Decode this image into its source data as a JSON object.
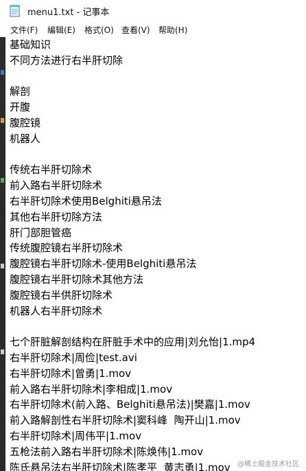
{
  "window": {
    "title": "menu1.txt - 记事本",
    "icon": "notepad-icon"
  },
  "menubar": {
    "items": [
      "文件(F)",
      "编辑(E)",
      "格式(O)",
      "查看(V)",
      "帮助(H)"
    ]
  },
  "document": {
    "lines": [
      "基础知识",
      "不同方法进行右半肝切除",
      "",
      "解剖",
      "开腹",
      "腹腔镜",
      "机器人",
      "",
      "传统右半肝切除术",
      "前入路右半肝切除术",
      "右半肝切除术使用Belghiti悬吊法",
      "其他右半肝切除方法",
      "肝门部胆管癌",
      "传统腹腔镜右半肝切除术",
      "腹腔镜右半肝切除术-使用Belghiti悬吊法",
      "腹腔镜右半肝切除术其他方法",
      "腹腔镜右半供肝切除术",
      "机器人右半肝切除术",
      "",
      "七个肝脏解剖结构在肝脏手术中的应用|刘允怡|1.mp4",
      "右半肝切除术|周俭|test.avi",
      "右半肝切除术|曾勇|1.mov",
      "前入路右半肝切除术|李相成|1.mov",
      "右半肝切除术(前入路、Belghiti悬吊法)|樊嘉|1.mov",
      "前入路解剖性右半肝切除术|窦科峰  陶开山|1.mov",
      "右半肝切除术|周伟平|1.mov",
      "五枪法前入路右半肝切除术|陈焕伟|1.mov",
      "陈氏悬吊法右半肝切除术|陈孝平  黄志勇|1.mov"
    ]
  },
  "watermark": "@稀土掘金技术社区"
}
